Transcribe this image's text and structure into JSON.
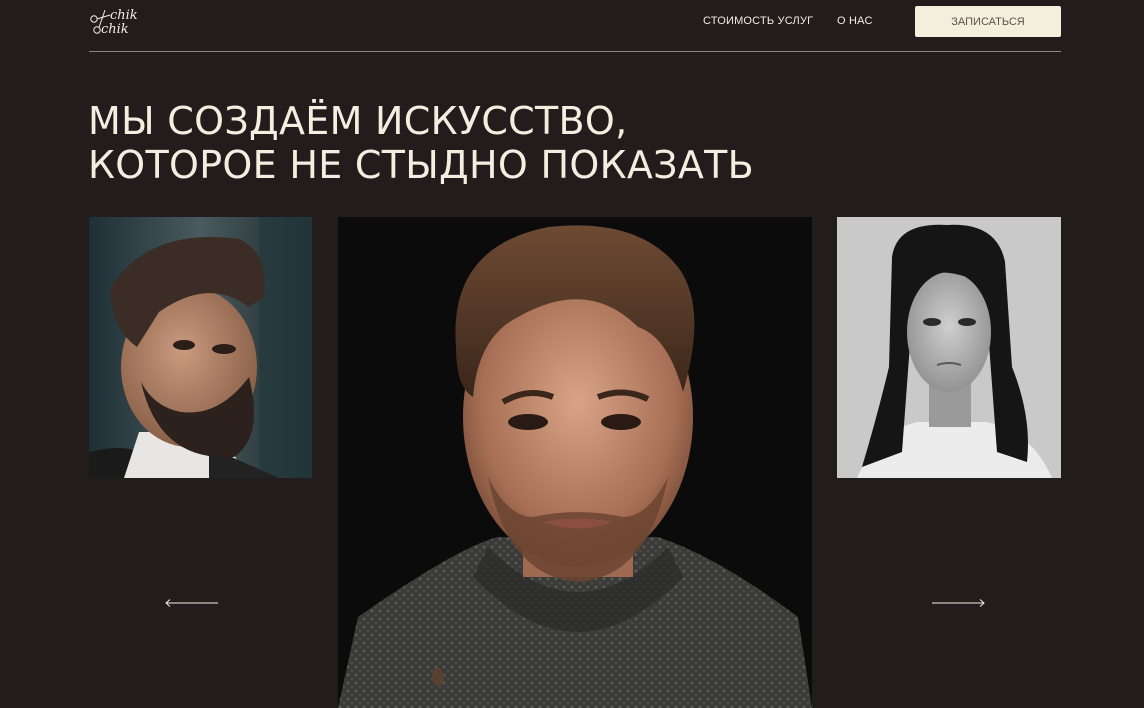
{
  "logo": {
    "line1": "chik",
    "line2": "chik",
    "icon": "scissors-icon"
  },
  "nav": {
    "prices": "Стоимость услуг",
    "about": "О нас"
  },
  "cta": {
    "label": "Записаться"
  },
  "hero": {
    "line1": "Мы создаём искусство,",
    "line2": "которое не стыдно показать"
  },
  "gallery": {
    "prev_icon": "arrow-left-icon",
    "next_icon": "arrow-right-icon"
  },
  "colors": {
    "background": "#231c1c",
    "text": "#f3eedf",
    "button_bg": "#f4efdc",
    "button_text": "#5a524c",
    "divider": "#8c8580"
  }
}
